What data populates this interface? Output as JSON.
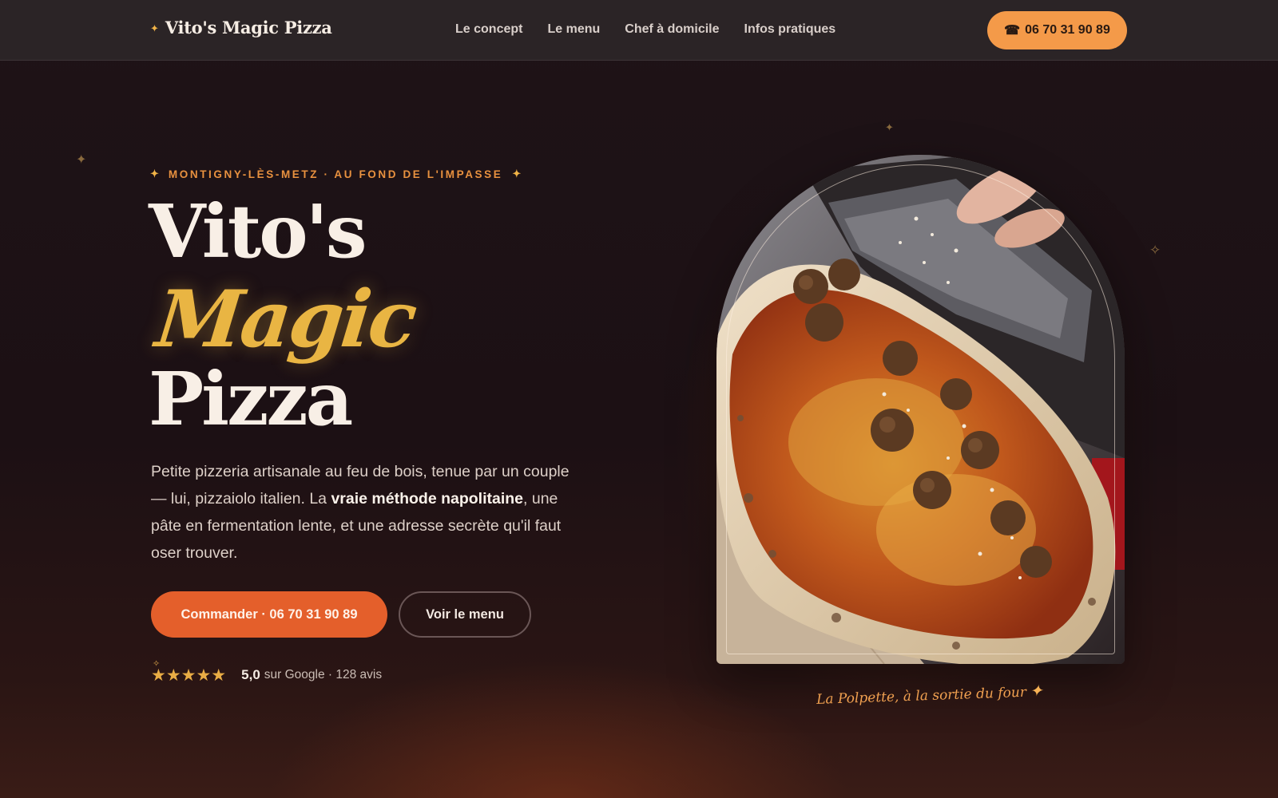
{
  "nav": {
    "brand_star": "✦",
    "brand": "Vito's Magic Pizza",
    "links": [
      "Le concept",
      "Le menu",
      "Chef à domicile",
      "Infos pratiques"
    ],
    "cta_icon": "☎",
    "cta": "06 70 31 90 89"
  },
  "hero": {
    "eyebrow_star": "✦",
    "eyebrow": "MONTIGNY-LÈS-METZ · AU FOND DE L'IMPASSE",
    "title_line1": "Vito's",
    "title_line2": "Magic",
    "title_line3": "Pizza",
    "desc_part1": "Petite pizzeria artisanale au feu de bois, tenue par un couple — lui, pizzaiolo italien. La ",
    "desc_bold": "vraie méthode napolitaine",
    "desc_part2": ", une pâte en fermentation lente, et une adresse secrète qu'il faut oser trouver.",
    "primary_button": "Commander · 06 70 31 90 89",
    "secondary_button": "Voir le menu",
    "rating_stars": "★★★★★",
    "rating_score": "5,0",
    "rating_text": "sur Google · 128 avis",
    "rating_value": 5,
    "rating_max": 5,
    "caption": "La Polpette, à la sortie du four",
    "caption_star": "✦",
    "photo_description_icon": "pizza-photo"
  },
  "colors": {
    "background": "#1d1216",
    "nav_background": "#2b2426",
    "accent_orange": "#f49a49",
    "primary_button": "#e45f2b",
    "gold": "#e9b543",
    "text_light": "#f8efe6"
  }
}
